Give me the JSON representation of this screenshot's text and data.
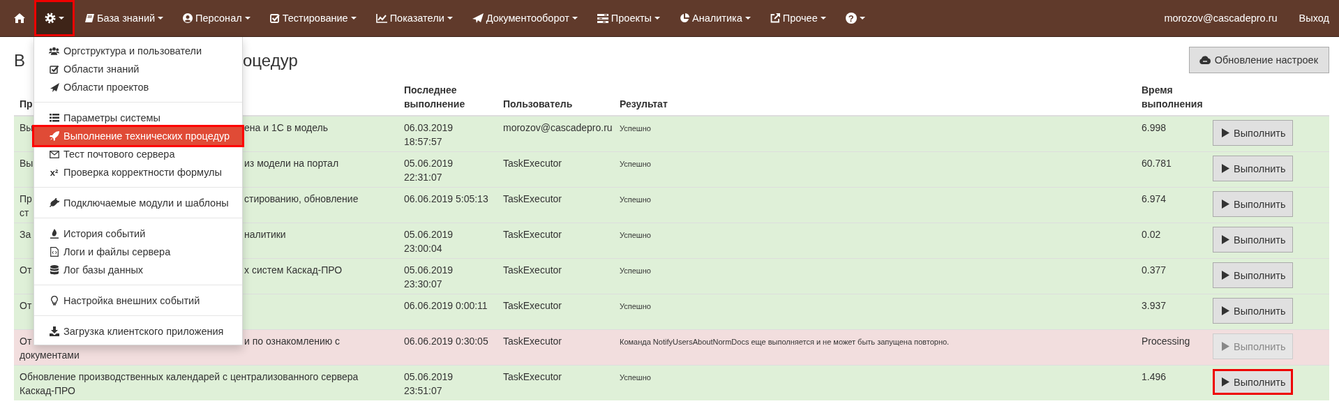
{
  "navbar": {
    "items": [
      {
        "selected": false,
        "highlighted": false,
        "caret": false
      },
      {
        "selected": true,
        "highlighted": true,
        "caret": true
      },
      {
        "label": "База знаний",
        "selected": false,
        "highlighted": false,
        "caret": true
      },
      {
        "label": "Персонал",
        "selected": false,
        "highlighted": false,
        "caret": true
      },
      {
        "label": "Тестирование",
        "selected": false,
        "highlighted": false,
        "caret": true
      },
      {
        "label": "Показатели",
        "selected": false,
        "highlighted": false,
        "caret": true
      },
      {
        "label": "Документооборот",
        "selected": false,
        "highlighted": false,
        "caret": true
      },
      {
        "label": "Проекты",
        "selected": false,
        "highlighted": false,
        "caret": true
      },
      {
        "label": "Аналитика",
        "selected": false,
        "highlighted": false,
        "caret": true
      },
      {
        "label": "Прочее",
        "selected": false,
        "highlighted": false,
        "caret": true
      },
      {
        "glyph": "?",
        "selected": false,
        "highlighted": false,
        "caret": true
      }
    ],
    "user": "morozov@cascadepro.ru",
    "logout": "Выход"
  },
  "page": {
    "title_start": "В",
    "title_end": "оцедур",
    "update_button": "Обновление настроек"
  },
  "menu": {
    "groups": [
      {
        "items": [
          {
            "label": "Оргструктура и пользователи",
            "selected": false,
            "highlighted": false
          },
          {
            "label": "Области знаний",
            "selected": false,
            "highlighted": false
          },
          {
            "label": "Области проектов",
            "selected": false,
            "highlighted": false
          }
        ]
      },
      {
        "items": [
          {
            "label": "Параметры системы",
            "selected": false,
            "highlighted": false
          },
          {
            "label": "Выполнение технических процедур",
            "selected": true,
            "highlighted": true
          },
          {
            "label": "Тест почтового сервера",
            "selected": false,
            "highlighted": false
          },
          {
            "glyph": "x²",
            "label": "Проверка корректности формулы",
            "selected": false,
            "highlighted": false
          }
        ]
      },
      {
        "items": [
          {
            "label": "Подключаемые модули и шаблоны",
            "selected": false,
            "highlighted": false
          }
        ]
      },
      {
        "items": [
          {
            "label": "История событий",
            "selected": false,
            "highlighted": false
          },
          {
            "label": "Логи и файлы сервера",
            "selected": false,
            "highlighted": false
          },
          {
            "label": "Лог базы данных",
            "selected": false,
            "highlighted": false
          }
        ]
      },
      {
        "items": [
          {
            "label": "Настройка внешних событий",
            "selected": false,
            "highlighted": false
          }
        ]
      },
      {
        "items": [
          {
            "label": "Загрузка клиентского приложения",
            "selected": false,
            "highlighted": false
          }
        ]
      }
    ]
  },
  "table": {
    "columns": [
      "Пр",
      "Последнее выполнение",
      "Пользователь",
      "Результат",
      "Время выполнения"
    ],
    "rows": [
      {
        "name_start": "Вы",
        "name_end": "ена и 1С в модель",
        "last_run": "06.03.2019 18:57:57",
        "user": "morozov@cascadepro.ru",
        "result": "Успешно",
        "time": "6.998",
        "color": "#dff0d8",
        "run_button": {
          "label": "Выполнить",
          "disabled": false,
          "highlighted": false
        }
      },
      {
        "name_start": "Вы",
        "name_end": "из модели на портал",
        "last_run": "05.06.2019 22:31:07",
        "user": "TaskExecutor",
        "result": "Успешно",
        "time": "60.781",
        "color": "#dff0d8",
        "run_button": {
          "label": "Выполнить",
          "disabled": false,
          "highlighted": false
        }
      },
      {
        "name_start": "Пр",
        "name_end": "стированию, обновление",
        "name_line2": "ст",
        "last_run": "06.06.2019 5:05:13",
        "user": "TaskExecutor",
        "result": "Успешно",
        "time": "6.974",
        "color": "#dff0d8",
        "run_button": {
          "label": "Выполнить",
          "disabled": false,
          "highlighted": false
        }
      },
      {
        "name_start": "За",
        "name_end": "налитики",
        "last_run": "05.06.2019 23:00:04",
        "user": "TaskExecutor",
        "result": "Успешно",
        "time": "0.02",
        "color": "#dff0d8",
        "run_button": {
          "label": "Выполнить",
          "disabled": false,
          "highlighted": false
        }
      },
      {
        "name_start": "От",
        "name_end": "х систем Каскад-ПРО",
        "last_run": "05.06.2019 23:30:07",
        "user": "TaskExecutor",
        "result": "Успешно",
        "time": "0.377",
        "color": "#dff0d8",
        "run_button": {
          "label": "Выполнить",
          "disabled": false,
          "highlighted": false
        }
      },
      {
        "name_start": "От",
        "last_run": "06.06.2019 0:00:11",
        "user": "TaskExecutor",
        "result": "Успешно",
        "time": "3.937",
        "color": "#dff0d8",
        "run_button": {
          "label": "Выполнить",
          "disabled": false,
          "highlighted": false
        }
      },
      {
        "name_start": "От",
        "name_end": "и по ознакомлению с",
        "name_line2": "документами",
        "last_run": "06.06.2019 0:30:05",
        "user": "TaskExecutor",
        "result": "Команда NotifyUsersAboutNormDocs еще выполняется и не может быть запущена повторно.",
        "time": "Processing",
        "color": "#f2dede",
        "run_button": {
          "label": "Выполнить",
          "disabled": true,
          "highlighted": false
        }
      },
      {
        "name": "Обновление производственных календарей с централизованного сервера Каскад-ПРО",
        "last_run": "05.06.2019 23:51:07",
        "user": "TaskExecutor",
        "result": "Успешно",
        "time": "1.496",
        "color": "#dff0d8",
        "run_button": {
          "label": "Выполнить",
          "disabled": false,
          "highlighted": true
        }
      }
    ]
  }
}
